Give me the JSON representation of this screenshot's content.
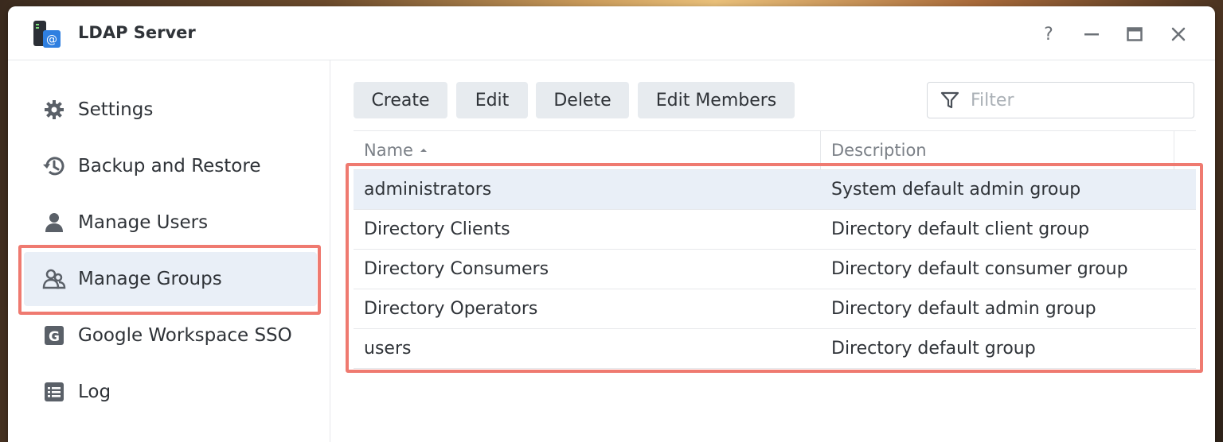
{
  "window": {
    "title": "LDAP Server",
    "controls": {
      "help": "?",
      "minimize": "—",
      "maximize": "□",
      "close": "✕"
    }
  },
  "sidebar": {
    "items": [
      {
        "label": "Settings",
        "icon": "gear-icon"
      },
      {
        "label": "Backup and Restore",
        "icon": "history-icon"
      },
      {
        "label": "Manage Users",
        "icon": "user-icon"
      },
      {
        "label": "Manage Groups",
        "icon": "group-icon",
        "active": true
      },
      {
        "label": "Google Workspace SSO",
        "icon": "google-g-icon"
      },
      {
        "label": "Log",
        "icon": "log-list-icon"
      }
    ]
  },
  "toolbar": {
    "create_label": "Create",
    "edit_label": "Edit",
    "delete_label": "Delete",
    "edit_members_label": "Edit Members",
    "filter_placeholder": "Filter"
  },
  "table": {
    "columns": [
      "Name",
      "Description"
    ],
    "sort": {
      "column": "Name",
      "direction": "ascending"
    },
    "rows": [
      {
        "name": "administrators",
        "description": "System default admin group",
        "selected": true
      },
      {
        "name": "Directory Clients",
        "description": "Directory default client group"
      },
      {
        "name": "Directory Consumers",
        "description": "Directory default consumer group"
      },
      {
        "name": "Directory Operators",
        "description": "Directory default admin group"
      },
      {
        "name": "users",
        "description": "Directory default group"
      }
    ]
  },
  "colors": {
    "highlight": "#ef7a70",
    "selected_row": "#e9eff7",
    "button_bg": "#e7ebef",
    "app_icon_blue": "#2f7fe0"
  }
}
